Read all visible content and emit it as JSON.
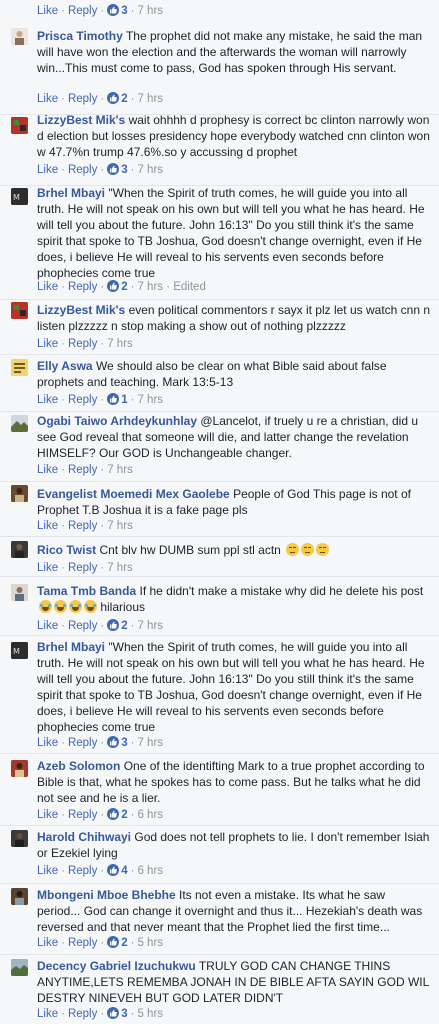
{
  "top_actions": {
    "like": "Like",
    "reply": "Reply",
    "count": "3",
    "time": "7 hrs"
  },
  "comments": [
    {
      "author": "Prisca Timothy",
      "text": "The prophet did not make any mistake, he said the man will have won the election and the afterwards the woman will narrowly win...This must come to pass, God has spoken through His servant.",
      "like": "Like",
      "reply": "Reply",
      "count": "2",
      "time": "7 hrs"
    },
    {
      "author": "LizzyBest Mik's",
      "text": "wait ohhhh d prophesy is correct bc clinton narrowly won d election but losses presidency hope everybody watched cnn clinton won w 47.7%n trump 47.6%.so y accussing d prophet",
      "like": "Like",
      "reply": "Reply",
      "count": "3",
      "time": "7 hrs"
    },
    {
      "author": "Brhel Mbayi",
      "text": "\"When the Spirit of truth comes, he will guide you into all truth. He will not speak on his own but will tell you what he has heard. He will tell you about the future. John 16:13\" Do you still think it's the same spirit that spoke to TB Joshua, God doesn't change overnight, even if He does, i believe He will reveal to his servents even seconds before phophecies come true",
      "like": "Like",
      "reply": "Reply",
      "count": "2",
      "time": "7 hrs · Edited"
    },
    {
      "author": "LizzyBest Mik's",
      "text": "even political commentors r sayx it plz let us watch cnn n listen plzzzzz n stop making a show out of nothing plzzzzz",
      "like": "Like",
      "reply": "Reply",
      "count": "",
      "time": "7 hrs"
    },
    {
      "author": "Elly Aswa",
      "text": "We should also be clear on what Bible said about false prophets and teaching. Mark 13:5-13",
      "like": "Like",
      "reply": "Reply",
      "count": "1",
      "time": "7 hrs"
    },
    {
      "author": "Ogabi Taiwo Arhdeykunhlay",
      "text": "@Lancelot, if truely u re a christian, did u see God reveal that someone will die, and latter change the revelation HIMSELF? Our GOD is Unchangeable changer.",
      "like": "Like",
      "reply": "Reply",
      "count": "",
      "time": "7 hrs"
    },
    {
      "author": "Evangelist Moemedi Mex Gaolebe",
      "text": "People of God This page is not of Prophet T.B Joshua it is a fake page pls",
      "like": "Like",
      "reply": "Reply",
      "count": "",
      "time": "7 hrs"
    },
    {
      "author": "Rico Twist",
      "text": "Cnt blv hw DUMB sum ppl stl actn",
      "like": "Like",
      "reply": "Reply",
      "count": "",
      "time": "7 hrs"
    },
    {
      "author": "Tama Tmb Banda",
      "text": "If he didn't make a mistake why did he delete his post",
      "text_after": "hilarious",
      "like": "Like",
      "reply": "Reply",
      "count": "2",
      "time": "7 hrs"
    },
    {
      "author": "Brhel Mbayi",
      "text": "\"When the Spirit of truth comes, he will guide you into all truth. He will not speak on his own but will tell you what he has heard. He will tell you about the future. John 16:13\" Do you still think it's the same spirit that spoke to TB Joshua, God doesn't change overnight, even if He does, i believe He will reveal to his servents even seconds before phophecies come true",
      "like": "Like",
      "reply": "Reply",
      "count": "3",
      "time": "7 hrs"
    },
    {
      "author": "Azeb Solomon",
      "text": "One of the identifting Mark to a true prophet according to Bible is that, what he spokes has to come pass. But he talks what he did not see and he is a lier.",
      "like": "Like",
      "reply": "Reply",
      "count": "2",
      "time": "6 hrs"
    },
    {
      "author": "Harold Chihwayi",
      "text": "God does not tell prophets to lie. I don't remember Isiah or Ezekiel lying",
      "like": "Like",
      "reply": "Reply",
      "count": "4",
      "time": "6 hrs"
    },
    {
      "author": "Mbongeni Mboe Bhebhe",
      "text": "Its not even a mistake. Its what he saw period... God can change it overnight and thus it... Hezekiah's death was reversed and that never meant that the Prophet lied the first time...",
      "like": "Like",
      "reply": "Reply",
      "count": "2",
      "time": "5 hrs"
    },
    {
      "author": "Decency Gabriel Izuchukwu",
      "text": "TRULY GOD CAN CHANGE THINS ANYTIME,LETS REMEMBA JONAH IN DE BIBLE AFTA SAYIN GOD WIL DESTRY NINEVEH BUT GOD LATER DIDN'T",
      "like": "Like",
      "reply": "Reply",
      "count": "3",
      "time": "5 hrs"
    }
  ],
  "colors": {
    "link": "#365899",
    "action": "#4267b2",
    "meta": "#90949c",
    "text": "#1d2129",
    "background": "#f6f7f9"
  }
}
